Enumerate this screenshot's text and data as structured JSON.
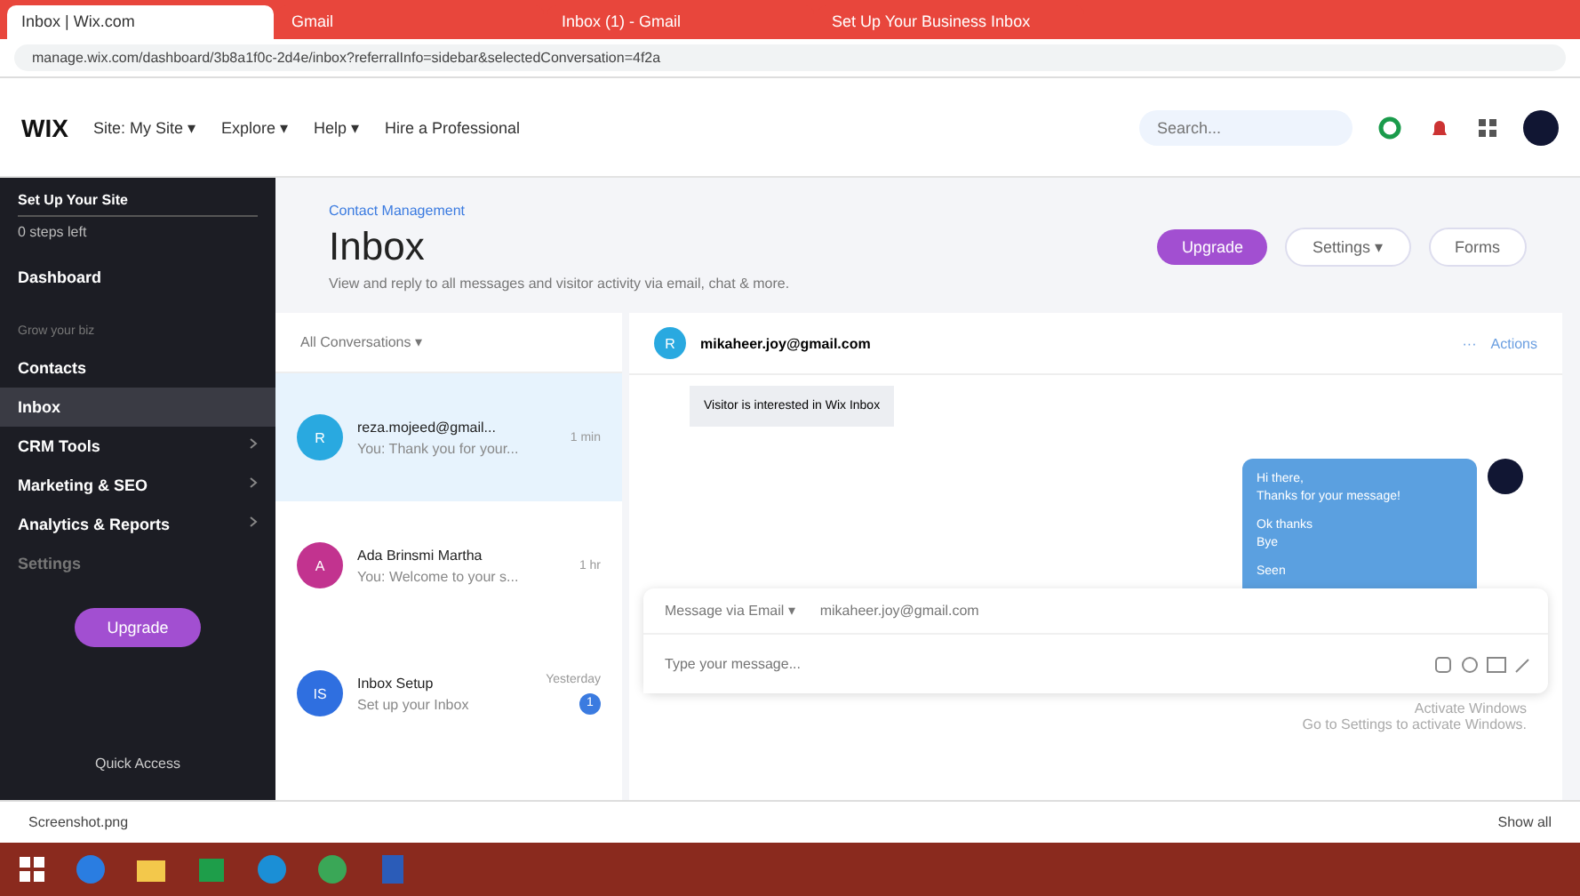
{
  "browser": {
    "tabs": [
      {
        "title": "Inbox | Wix.com",
        "selected": true
      },
      {
        "title": "Gmail",
        "selected": false
      },
      {
        "title": "Inbox (1) - Gmail",
        "selected": false
      },
      {
        "title": "Set Up Your Business Inbox",
        "selected": false
      }
    ],
    "url": "manage.wix.com/dashboard/3b8a1f0c-2d4e/inbox?referralInfo=sidebar&selectedConversation=4f2a"
  },
  "topbar": {
    "logo": "WIX",
    "menus": [
      "Site: My Site ▾",
      "Explore ▾",
      "Help ▾",
      "Hire a Professional"
    ],
    "search": {
      "placeholder": "Search..."
    }
  },
  "sidebar": {
    "setup_title": "Set Up Your Site",
    "setup_sub": "0 steps left",
    "items": [
      {
        "label": "Dashboard",
        "kind": "link",
        "selected": false
      },
      {
        "label": "Grow your biz",
        "kind": "section",
        "selected": false
      },
      {
        "label": "Contacts",
        "kind": "link",
        "selected": false
      },
      {
        "label": "Inbox",
        "kind": "link",
        "selected": true
      },
      {
        "label": "CRM Tools",
        "kind": "group",
        "selected": false
      },
      {
        "label": "Marketing & SEO",
        "kind": "group",
        "selected": false
      },
      {
        "label": "Analytics & Reports",
        "kind": "group",
        "selected": false
      },
      {
        "label": "Settings",
        "kind": "faded",
        "selected": false
      }
    ],
    "upgrade": "Upgrade",
    "quick": "Quick Access"
  },
  "page": {
    "breadcrumb": "Contact Management",
    "title": "Inbox",
    "description": "View and reply to all messages and visitor activity via email, chat & more.",
    "buttons": [
      {
        "label": "Upgrade",
        "kind": "primary"
      },
      {
        "label": "Settings ▾",
        "kind": "secondary"
      },
      {
        "label": "Forms",
        "kind": "secondary"
      }
    ]
  },
  "list": {
    "filter": "All Conversations ▾",
    "conversations": [
      {
        "initial": "R",
        "color": "#29a9e0",
        "name": "reza.mojeed@gmail...",
        "preview": "You: Thank you for your...",
        "time": "1 min",
        "selected": true
      },
      {
        "initial": "A",
        "color": "#c2338f",
        "name": "Ada Brinsmi Martha",
        "preview": "You: Welcome to your s...",
        "time": "1 hr",
        "selected": false
      },
      {
        "initial": "IS",
        "color": "#2f6fe0",
        "name": "Inbox Setup",
        "preview": "Set up your Inbox",
        "time": "Yesterday",
        "unread": "1",
        "selected": false
      }
    ]
  },
  "chat": {
    "avatar": "R",
    "contact": "mikaheer.joy@gmail.com",
    "more": "···",
    "actions": "Actions",
    "notice": "Visitor is interested in Wix Inbox",
    "bubble": [
      [
        "Hi there,",
        "Thanks for your message!"
      ],
      [
        "Ok thanks",
        "Bye"
      ]
    ],
    "seen": "Seen",
    "channel": "Message via Email ▾",
    "to": "mikaheer.joy@gmail.com",
    "placeholder": "Type your message..."
  },
  "activation": [
    "Activate Windows",
    "Go to Settings to activate Windows."
  ],
  "downloads": {
    "file": "Screenshot.png",
    "show_all": "Show all"
  }
}
